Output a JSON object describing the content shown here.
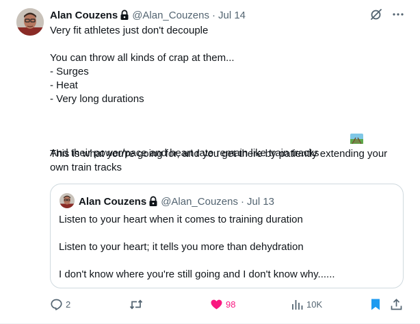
{
  "tweet": {
    "author_name": "Alan Couzens",
    "author_handle": "@Alan_Couzens",
    "separator": "·",
    "date": "Jul 14",
    "body_lines": [
      "Very fit athletes just don't decouple",
      "",
      "You can throw all kinds of crap at them...",
      "- Surges",
      "- Heat",
      "- Very long durations",
      "",
      "And their power/pace and heart rate remain like train tracks",
      "",
      "This is what you're going for, and you get there by patiently extending your",
      "own train tracks"
    ],
    "icons": {
      "verified": "lock-icon",
      "grok": "grok-icon",
      "more": "more-icon",
      "emoji": "railway-track-emoji"
    }
  },
  "quote": {
    "author_name": "Alan Couzens",
    "author_handle": "@Alan_Couzens",
    "separator": "·",
    "date": "Jul 13",
    "body_lines": [
      "Listen to your heart when it comes to training duration",
      "",
      "Listen to your heart; it tells you more than dehydration",
      "",
      "I don't know where you're still going and I don't know why......"
    ]
  },
  "actions": {
    "replies": "2",
    "retweets": "",
    "likes": "98",
    "views": "10K",
    "like_color": "#f91880",
    "bookmark_color": "#1d9bf0",
    "muted_color": "#536471"
  }
}
